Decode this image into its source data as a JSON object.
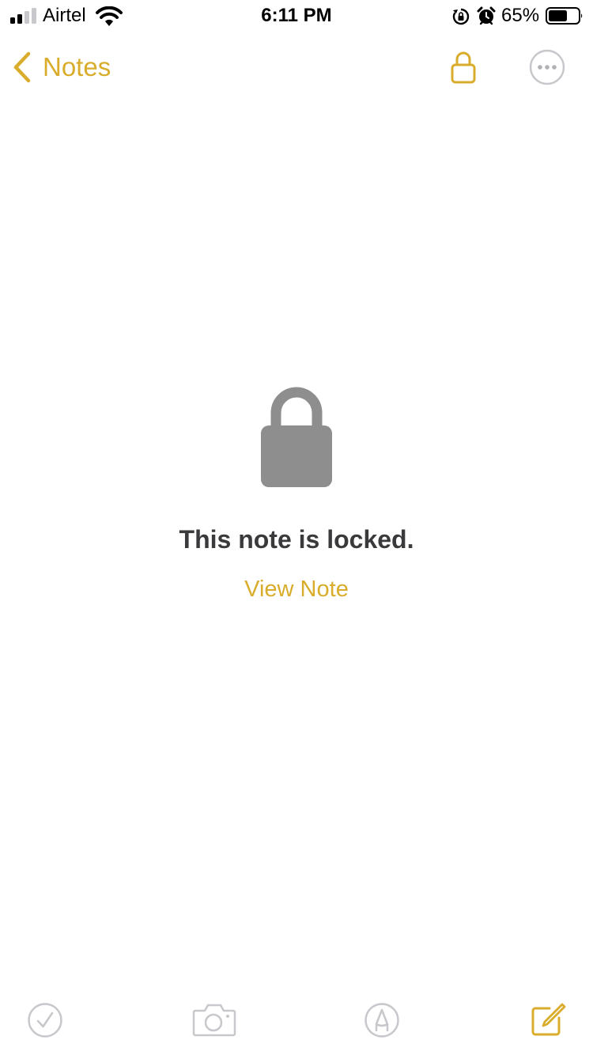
{
  "status_bar": {
    "carrier": "Airtel",
    "time": "6:11 PM",
    "battery_percent": "65%",
    "battery_level": 0.65,
    "signal_bars_active": 2,
    "icons": [
      "signal-icon",
      "wifi-icon",
      "orientation-lock-icon",
      "alarm-icon",
      "battery-icon"
    ]
  },
  "nav": {
    "back_label": "Notes",
    "icons": [
      "chevron-left-icon",
      "lock-icon",
      "more-icon"
    ]
  },
  "locked": {
    "icon": "lock-icon",
    "message": "This note is locked.",
    "action_label": "View Note"
  },
  "toolbar": {
    "items": [
      "checklist-icon",
      "camera-icon",
      "markup-icon",
      "compose-icon"
    ]
  },
  "colors": {
    "accent": "#d9ad2b",
    "lock_gray": "#8e8e8e",
    "title_text": "#3a3a3c",
    "toolbar_gray": "#c7c7cc"
  }
}
